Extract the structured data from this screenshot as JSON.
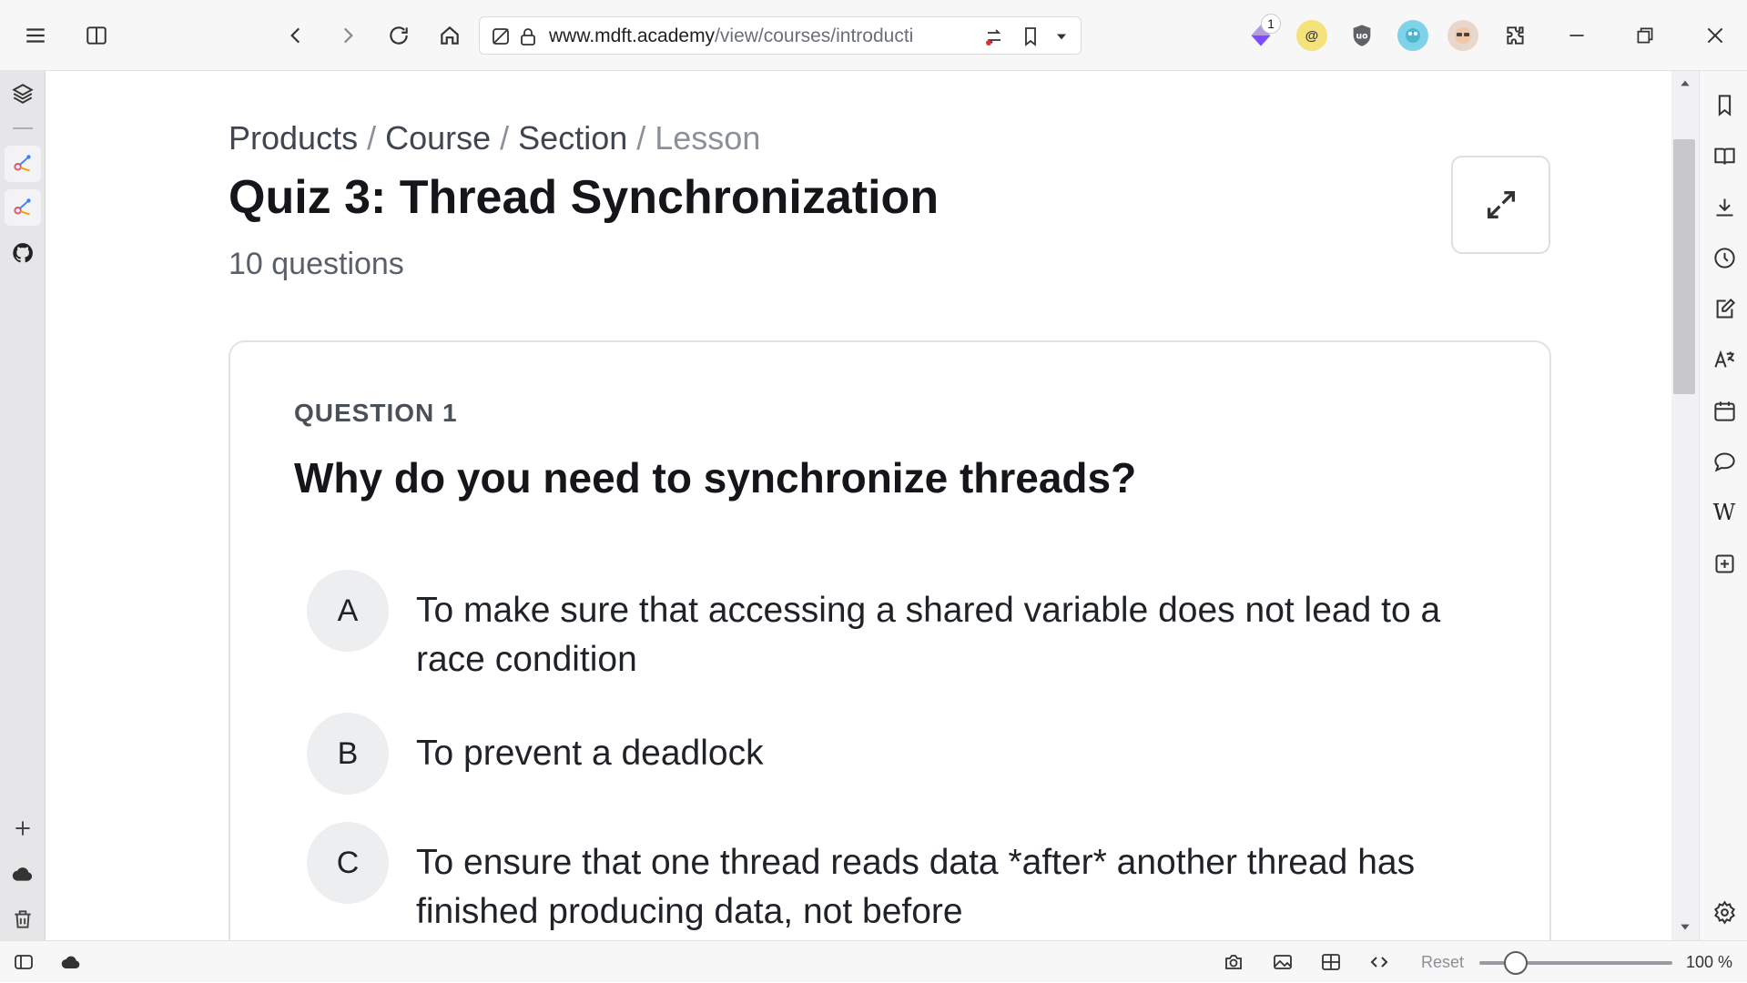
{
  "browser": {
    "url_host": "www.mdft.academy",
    "url_path": "/view/courses/introduction-to-",
    "extension_badge": "1",
    "colors": {
      "toolbar_bg": "#f7f7f8",
      "accent": "#5b4bd6"
    }
  },
  "toolbar": {
    "icons": [
      "menu-icon",
      "split-view-icon",
      "back-icon",
      "forward-icon",
      "reload-icon",
      "home-icon",
      "tracking-off-icon",
      "lock-icon",
      "share-icon",
      "bookmark-icon",
      "dropdown-icon",
      "puzzle-icon",
      "minimize-icon",
      "restore-icon",
      "close-icon"
    ]
  },
  "left_panel": {
    "icons": [
      "layers-icon",
      "web-panel-icon",
      "web-panel-icon",
      "github-icon",
      "add-icon",
      "cloud-icon",
      "trash-icon"
    ]
  },
  "right_panel": {
    "icons": [
      "bookmark-icon",
      "reading-list-icon",
      "downloads-icon",
      "history-icon",
      "notes-icon",
      "translate-icon",
      "calendar-icon",
      "chat-icon",
      "wikipedia-icon",
      "add-panel-icon",
      "settings-icon"
    ],
    "wikipedia_glyph": "W"
  },
  "statusbar": {
    "reset_label": "Reset",
    "zoom_label": "100 %",
    "zoom_value": 100
  },
  "page": {
    "breadcrumb": {
      "products": "Products",
      "course": "Course",
      "section": "Section",
      "lesson": "Lesson",
      "separator": "/"
    },
    "title": "Quiz 3: Thread Synchronization",
    "subtitle": "10 questions",
    "question": {
      "label": "QUESTION 1",
      "text": "Why do you need to synchronize threads?",
      "options": [
        {
          "letter": "A",
          "text": "To make sure that accessing a shared variable does not lead to a race condition"
        },
        {
          "letter": "B",
          "text": "To prevent a deadlock"
        },
        {
          "letter": "C",
          "text": "To ensure that one thread reads data *after* another thread has finished producing data, not before"
        }
      ]
    }
  }
}
